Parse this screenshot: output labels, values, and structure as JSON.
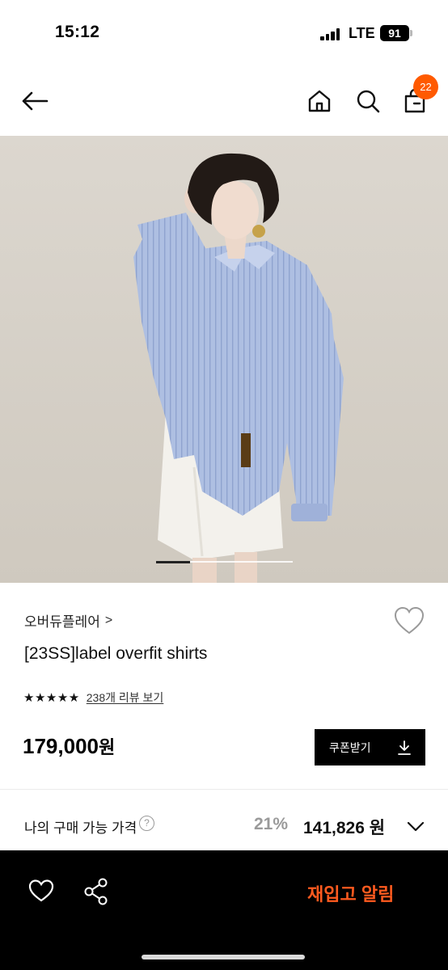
{
  "status_bar": {
    "time": "15:12",
    "network": "LTE",
    "battery": "91"
  },
  "nav": {
    "back_icon": "arrow-left-icon",
    "home_icon": "home-icon",
    "search_icon": "search-icon",
    "cart_icon": "shopping-bag-icon",
    "cart_count": "22"
  },
  "gallery": {
    "slide_progress": 0.25,
    "image_desc_icon": "product-photo"
  },
  "product": {
    "brand": "오버듀플레어",
    "brand_chevron": ">",
    "name": "[23SS]label overfit shirts",
    "stars": "★★★★★",
    "rating_value": 5,
    "review_link": "238개 리뷰 보기",
    "price_number": "179,000",
    "price_unit": "원",
    "coupon_label": "쿠폰받기"
  },
  "my_price": {
    "label": "나의 구매 가능 가격",
    "help": "?",
    "discount": "21%",
    "price": "141,826 원"
  },
  "bottom": {
    "restock_label": "재입고 알림"
  },
  "colors": {
    "accent": "#ff5a1f",
    "badge": "#ff5a00",
    "shirt": "#a9bce0"
  }
}
